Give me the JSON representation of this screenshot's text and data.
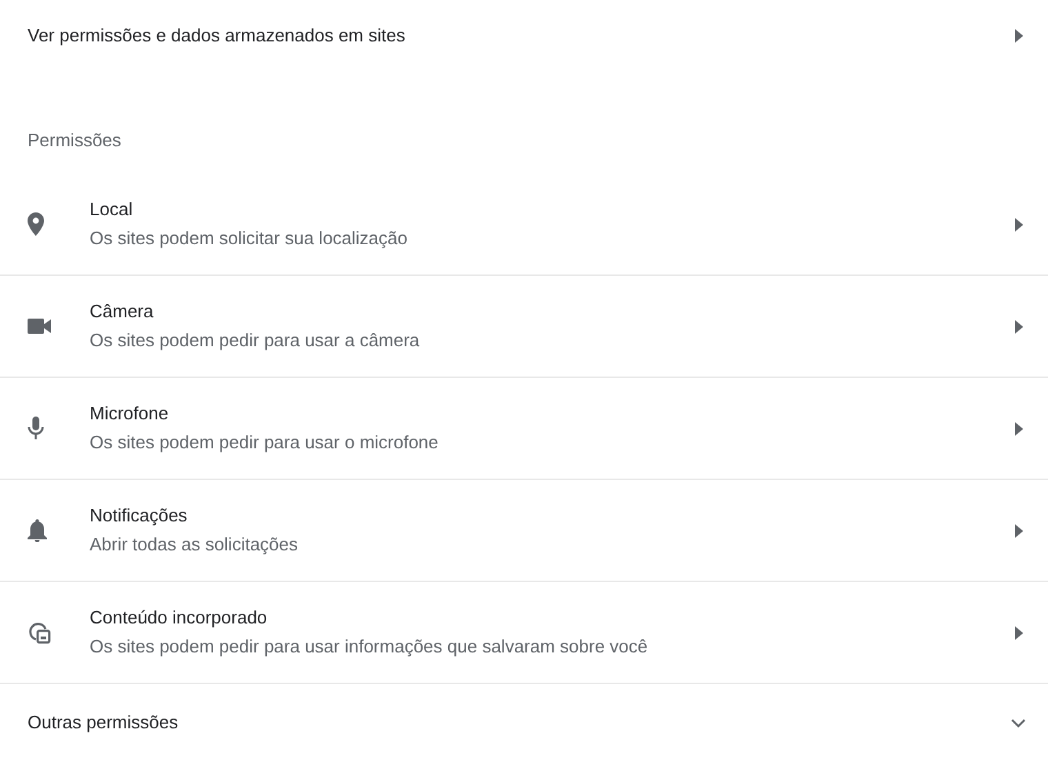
{
  "top_link": {
    "label": "Ver permissões e dados armazenados em sites"
  },
  "section": {
    "heading": "Permissões"
  },
  "permissions": [
    {
      "kind": "location",
      "title": "Local",
      "subtitle": "Os sites podem solicitar sua localização"
    },
    {
      "kind": "camera",
      "title": "Câmera",
      "subtitle": "Os sites podem pedir para usar a câmera"
    },
    {
      "kind": "microphone",
      "title": "Microfone",
      "subtitle": "Os sites podem pedir para usar o microfone"
    },
    {
      "kind": "notifications",
      "title": "Notificações",
      "subtitle": "Abrir todas as solicitações"
    },
    {
      "kind": "embedded",
      "title": "Conteúdo incorporado",
      "subtitle": "Os sites podem pedir para usar informações que salvaram sobre você"
    }
  ],
  "more": {
    "label": "Outras permissões",
    "expanded": false
  }
}
